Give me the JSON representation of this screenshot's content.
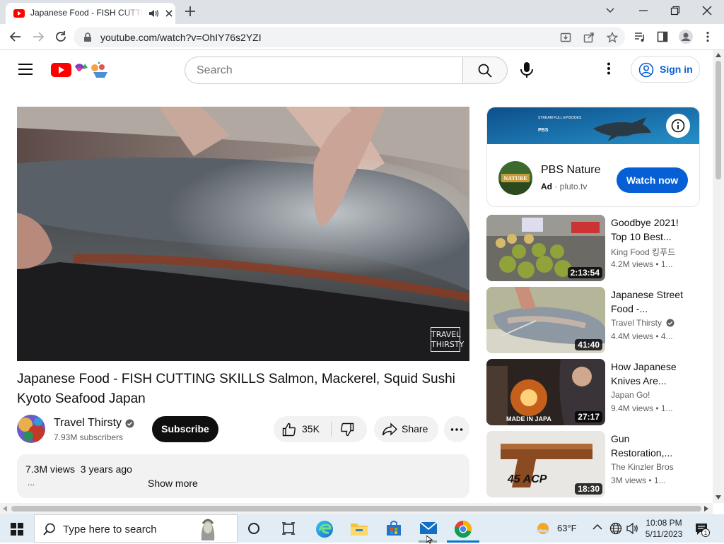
{
  "browser": {
    "tab_title": "Japanese Food - FISH CUTTING SKILLS Salmon, Mackerel, Squid Sushi Kyoto Seafood Japan",
    "url": "youtube.com/watch?v=OhIY76s2YZI"
  },
  "youtube": {
    "search_placeholder": "Search",
    "sign_in_label": "Sign in"
  },
  "video": {
    "title": "Japanese Food - FISH CUTTING SKILLS Salmon, Mackerel, Squid Sushi Kyoto Seafood Japan",
    "watermark": "TRAVEL THIRSTY",
    "channel": "Travel Thirsty",
    "subscribers": "7.93M subscribers",
    "subscribe_label": "Subscribe",
    "likes": "35K",
    "share_label": "Share",
    "views_age": "7.3M views  3 years ago",
    "desc_ellipsis": "...",
    "show_more": "Show more"
  },
  "ad": {
    "title": "PBS Nature",
    "badge": "Ad",
    "domain": "pluto.tv",
    "cta": "Watch now",
    "logo_text": "NATURE",
    "banner_caption": "STREAM FULL EPISODES",
    "banner_brand": "PBS"
  },
  "recommendations": [
    {
      "title": "Goodbye 2021! Top 10 Best...",
      "channel": "King Food 킹푸드",
      "views": "4.2M views",
      "age": "1...",
      "duration": "2:13:54",
      "verified": false
    },
    {
      "title": "Japanese Street Food -...",
      "channel": "Travel Thirsty",
      "views": "4.4M views",
      "age": "4...",
      "duration": "41:40",
      "verified": true
    },
    {
      "title": "How Japanese Knives Are...",
      "channel": "Japan Go!",
      "views": "9.4M views",
      "age": "1...",
      "duration": "27:17",
      "verified": false,
      "overlay": "MADE IN JAPA"
    },
    {
      "title": "Gun Restoration,...",
      "channel": "The Kinzler Bros",
      "views": "3M views",
      "age": "1...",
      "duration": "18:30",
      "verified": false,
      "overlay": "45 ACP"
    }
  ],
  "taskbar": {
    "search_placeholder": "Type here to search",
    "temperature": "63°F",
    "time": "10:08 PM",
    "date": "5/11/2023",
    "notification_count": "1"
  },
  "colors": {
    "youtube_red": "#ff0000",
    "link_blue": "#065fd4"
  }
}
